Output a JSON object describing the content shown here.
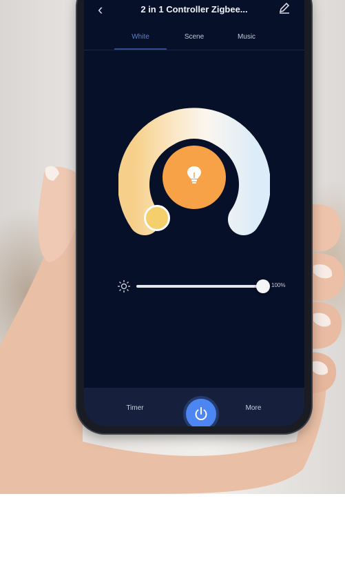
{
  "header": {
    "title": "2 in 1 Controller Zigbee...",
    "back_icon": "chevron-left-icon",
    "edit_icon": "pencil-icon"
  },
  "tabs": [
    {
      "label": "White",
      "active": true
    },
    {
      "label": "Scene",
      "active": false
    },
    {
      "label": "Music",
      "active": false
    }
  ],
  "color_temperature": {
    "warm_color": "#f7d7a0",
    "cool_color": "#e4f1fb",
    "bulb_button_color": "#f7a246",
    "bulb_icon": "lightbulb-icon"
  },
  "brightness": {
    "icon": "sun-icon",
    "value": "100%",
    "level": 1.0
  },
  "bottom_bar": {
    "timer_label": "Timer",
    "more_label": "More",
    "power_icon": "power-icon",
    "power_color": "#4d86f2"
  }
}
